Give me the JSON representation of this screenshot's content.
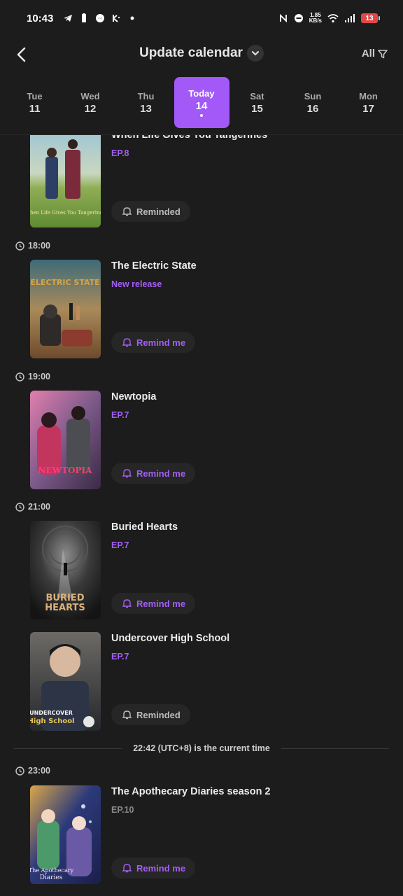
{
  "status": {
    "time": "10:43",
    "net_speed_value": "1.85",
    "net_speed_unit": "KB/s",
    "battery": "13"
  },
  "header": {
    "title": "Update calendar",
    "filter_label": "All"
  },
  "days": [
    {
      "name": "Tue",
      "date": "11"
    },
    {
      "name": "Wed",
      "date": "12"
    },
    {
      "name": "Thu",
      "date": "13"
    },
    {
      "name": "Today",
      "date": "14"
    },
    {
      "name": "Sat",
      "date": "15"
    },
    {
      "name": "Sun",
      "date": "16"
    },
    {
      "name": "Mon",
      "date": "17"
    }
  ],
  "times": [
    "18:00",
    "19:00",
    "21:00",
    "23:00"
  ],
  "items": [
    {
      "title": "When Life Gives You Tangerines",
      "sub": "EP.8",
      "remind": "Reminded",
      "poster_text": "When Life Gives You Tangerines"
    },
    {
      "title": "The Electric State",
      "sub": "New release",
      "remind": "Remind me",
      "poster_text": "ELECTRIC STATE"
    },
    {
      "title": "Newtopia",
      "sub": "EP.7",
      "remind": "Remind me",
      "poster_text": "NEWTOPIA"
    },
    {
      "title": "Buried Hearts",
      "sub": "EP.7",
      "remind": "Remind me",
      "poster_text": "BURIED HEARTS"
    },
    {
      "title": "Undercover High School",
      "sub": "EP.7",
      "remind": "Reminded",
      "poster_text": "UNDERCOVER High School"
    },
    {
      "title": "The Apothecary Diaries season 2",
      "sub": "EP.10",
      "remind": "Remind me",
      "poster_text": "The Apothecary Diaries"
    }
  ],
  "now_line": "22:42 (UTC+8) is the current time",
  "colors": {
    "accent": "#a259f7",
    "background": "#1c1c1c",
    "button_bg": "#262626"
  }
}
